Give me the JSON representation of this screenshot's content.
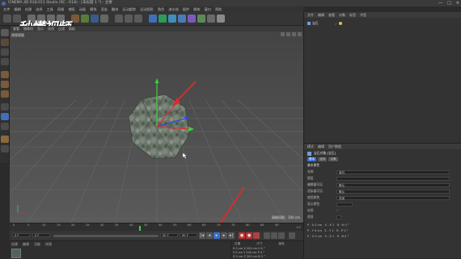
{
  "window": {
    "title": "CINEMA 4D R18.011 Studio (RC - R18) - [未标题 1 *] - 主要",
    "controls": [
      "—",
      "□",
      "✕"
    ]
  },
  "menubar": {
    "items": [
      "文件",
      "编辑",
      "创建",
      "选择",
      "工具",
      "网格",
      "捕捉",
      "动画",
      "模拟",
      "渲染",
      "雕刻",
      "运动跟踪",
      "运动图形",
      "角色",
      "流水线",
      "插件",
      "脚本",
      "窗口",
      "帮助"
    ]
  },
  "watermark": "秒懂视频",
  "viewport": {
    "menu": [
      "查看",
      "摄像机",
      "显示",
      "选项",
      "过滤",
      "面板"
    ],
    "label": "透视视图",
    "grid_text": "网格间距：100 cm"
  },
  "timeline": {
    "ticks": [
      "0",
      "5",
      "10",
      "15",
      "20",
      "25",
      "30",
      "35",
      "40",
      "45",
      "50",
      "55",
      "60",
      "65",
      "70",
      "75",
      "80",
      "85",
      "90"
    ],
    "end_label": "0 F",
    "current_frame": "0 F",
    "start_field": "0 F",
    "end_field": "90 F",
    "end_field2": "90 F"
  },
  "bottom_tabs": [
    "创建",
    "编辑",
    "功能",
    "纹理"
  ],
  "coords": {
    "header": [
      "位置",
      "尺寸",
      "旋转"
    ],
    "rows": [
      {
        "a": "X",
        "v1": "0 cm",
        "b": "X",
        "v2": "200 cm",
        "c": "H",
        "v3": "0 °"
      },
      {
        "a": "Y",
        "v1": "0 cm",
        "b": "Y",
        "v2": "200 cm",
        "c": "P",
        "v3": "0 °"
      },
      {
        "a": "Z",
        "v1": "0 cm",
        "b": "Z",
        "v2": "200 cm",
        "c": "B",
        "v3": "0 °"
      }
    ]
  },
  "object_manager": {
    "menu": [
      "文件",
      "编辑",
      "查看",
      "对象",
      "标签",
      "书签"
    ],
    "items": [
      {
        "name": "宝石",
        "checked": true
      }
    ]
  },
  "attribute_manager": {
    "menu": [
      "模式",
      "编辑",
      "用户数据"
    ],
    "object_title": "宝石对象 [宝石]",
    "tabs": [
      "基本",
      "坐标",
      "对象"
    ],
    "section": "基本属性",
    "rows": [
      {
        "label": "名称",
        "value": "宝石"
      },
      {
        "label": "图层",
        "value": ""
      },
      {
        "label": "编辑器可见",
        "value": "默认"
      },
      {
        "label": "渲染器可见",
        "value": "默认"
      },
      {
        "label": "使用颜色",
        "value": "关闭"
      },
      {
        "label": "显示颜色",
        "value": ""
      },
      {
        "label": "启用",
        "value": "✓"
      },
      {
        "label": "透显",
        "value": ""
      }
    ],
    "coord_rows": [
      {
        "l1": "P . X",
        "v1": "0 cm",
        "l2": "S . X",
        "v2": "1",
        "l3": "R . H",
        "v3": "0 °"
      },
      {
        "l1": "P . Y",
        "v1": "0 cm",
        "l2": "S . Y",
        "v2": "1",
        "l3": "R . P",
        "v3": "0 °"
      },
      {
        "l1": "P . Z",
        "v1": "0 cm",
        "l2": "S . Z",
        "v2": "1",
        "l3": "R . B",
        "v3": "0 °"
      }
    ]
  },
  "colors": {
    "accent_red": "#e02a2a",
    "axis_green": "#3fd13f",
    "axis_blue": "#2d4fd6",
    "axis_red": "#d83030",
    "play_blue": "#3a6fd0"
  }
}
